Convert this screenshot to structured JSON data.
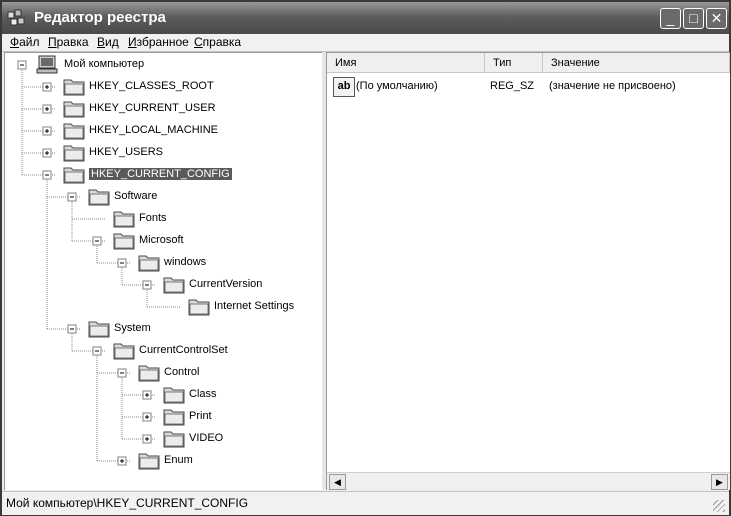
{
  "window": {
    "title": "Редактор реестра"
  },
  "menu": [
    {
      "u": "Ф",
      "rest": "айл"
    },
    {
      "u": "П",
      "rest": "равка"
    },
    {
      "u": "В",
      "rest": "ид"
    },
    {
      "u": "И",
      "rest": "збранное"
    },
    {
      "u": "С",
      "rest": "правка"
    }
  ],
  "tree": {
    "root": "Мой компьютер",
    "nodes": [
      {
        "label": "HKEY_CLASSES_ROOT",
        "depth": 1,
        "expander": "plus",
        "selected": false
      },
      {
        "label": "HKEY_CURRENT_USER",
        "depth": 1,
        "expander": "plus",
        "selected": false
      },
      {
        "label": "HKEY_LOCAL_MACHINE",
        "depth": 1,
        "expander": "plus",
        "selected": false
      },
      {
        "label": "HKEY_USERS",
        "depth": 1,
        "expander": "plus",
        "selected": false
      },
      {
        "label": "HKEY_CURRENT_CONFIG",
        "depth": 1,
        "expander": "minus",
        "selected": true
      },
      {
        "label": "Software",
        "depth": 2,
        "expander": "minus",
        "selected": false
      },
      {
        "label": "Fonts",
        "depth": 3,
        "expander": "none",
        "selected": false
      },
      {
        "label": "Microsoft",
        "depth": 3,
        "expander": "minus",
        "selected": false
      },
      {
        "label": "windows",
        "depth": 4,
        "expander": "minus",
        "selected": false
      },
      {
        "label": "CurrentVersion",
        "depth": 5,
        "expander": "minus",
        "selected": false
      },
      {
        "label": "Internet Settings",
        "depth": 6,
        "expander": "none",
        "selected": false
      },
      {
        "label": "System",
        "depth": 2,
        "expander": "minus",
        "selected": false
      },
      {
        "label": "CurrentControlSet",
        "depth": 3,
        "expander": "minus",
        "selected": false
      },
      {
        "label": "Control",
        "depth": 4,
        "expander": "minus",
        "selected": false
      },
      {
        "label": "Class",
        "depth": 5,
        "expander": "plus",
        "selected": false
      },
      {
        "label": "Print",
        "depth": 5,
        "expander": "plus",
        "selected": false
      },
      {
        "label": "VIDEO",
        "depth": 5,
        "expander": "plus",
        "selected": false
      },
      {
        "label": "Enum",
        "depth": 4,
        "expander": "plus",
        "selected": false
      }
    ]
  },
  "list": {
    "columns": [
      "Имя",
      "Тип",
      "Значение"
    ],
    "rows": [
      {
        "icon": "ab",
        "name": "(По умолчанию)",
        "type": "REG_SZ",
        "value": "(значение не присвоено)"
      }
    ]
  },
  "status": "Мой компьютер\\HKEY_CURRENT_CONFIG",
  "colors": {
    "title_bar": "#5d5d5d",
    "selection": "#5a5a5a",
    "folder": "#d9d9d9"
  },
  "icons": [
    "regedit-icon",
    "minimize-icon",
    "maximize-icon",
    "close-icon",
    "computer-icon",
    "folder-icon",
    "string-value-icon",
    "scroll-left-icon",
    "scroll-right-icon"
  ]
}
